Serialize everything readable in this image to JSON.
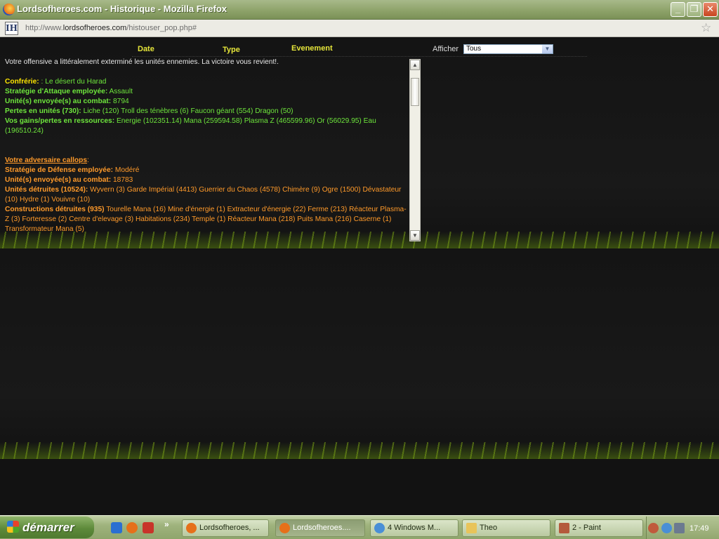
{
  "window": {
    "title": "Lordsofheroes.com - Historique - Mozilla Firefox",
    "controls": {
      "minimize": "_",
      "maximize": "❐",
      "close": "✕"
    }
  },
  "address": {
    "prefix": "http://www.",
    "domain": "lordsofheroes.com",
    "path": "/histouser_pop.php#",
    "site_icon": "IH"
  },
  "header": {
    "col_date": "Date",
    "col_type": "Type",
    "col_event": "Evenement",
    "filter_label": "Afficher",
    "filter_value": "Tous"
  },
  "report": {
    "intro": "Votre offensive a littéralement exterminé les unités ennemies. La victoire vous revient!.",
    "confrerie_label": "Confrérie:",
    "confrerie_value": ": Le désert du Harad",
    "strategy_label": "Stratégie d'Attaque employée:",
    "strategy_value": "Assault",
    "sent_label": "Unité(s) envoyée(s) au combat:",
    "sent_value": "8794",
    "losses_label": "Pertes en unités (730):",
    "losses_value": "Liche (120) Troll des ténèbres (6) Faucon géant (554) Dragon (50)",
    "gains_label": "Vos gains/pertes en ressources:",
    "gains_value": "Energie (102351.14) Mana (259594.58) Plasma Z (465599.96) Or (56029.95) Eau (196510.24)",
    "opponent_label": "Votre adversaire callops",
    "opponent_suffix": ":",
    "def_strategy_label": "Stratégie de Défense employée:",
    "def_strategy_value": "Modéré",
    "def_sent_label": "Unité(s) envoyée(s) au combat:",
    "def_sent_value": "18783",
    "destroyed_units_label": "Unités détruites (10524):",
    "destroyed_units_value": "Wyvern (3) Garde Impérial (4413) Guerrier du Chaos (4578) Chimère (9) Ogre (1500) Dévastateur (10) Hydre (1) Vouivre (10)",
    "destroyed_buildings_label": "Constructions détruites (935)",
    "destroyed_buildings_value": "Tourelle Mana (16) Mine d'énergie (1) Extracteur d'énergie (22) Ferme (213) Réacteur Plasma-Z (3) Forteresse (2) Centre d'elevage (3) Habitations (234) Temple (1) Réacteur Mana (218) Puits Mana (216) Caserne (1) Transformateur Mana (5)"
  },
  "taskbar": {
    "start_label": "démarrer",
    "more": "»",
    "tasks": [
      {
        "label": "Lordsofheroes, ..."
      },
      {
        "label": "Lordsofheroes...."
      },
      {
        "label": "4 Windows M..."
      },
      {
        "label": "Theo"
      },
      {
        "label": "2 - Paint"
      }
    ],
    "clock": "17:49"
  }
}
